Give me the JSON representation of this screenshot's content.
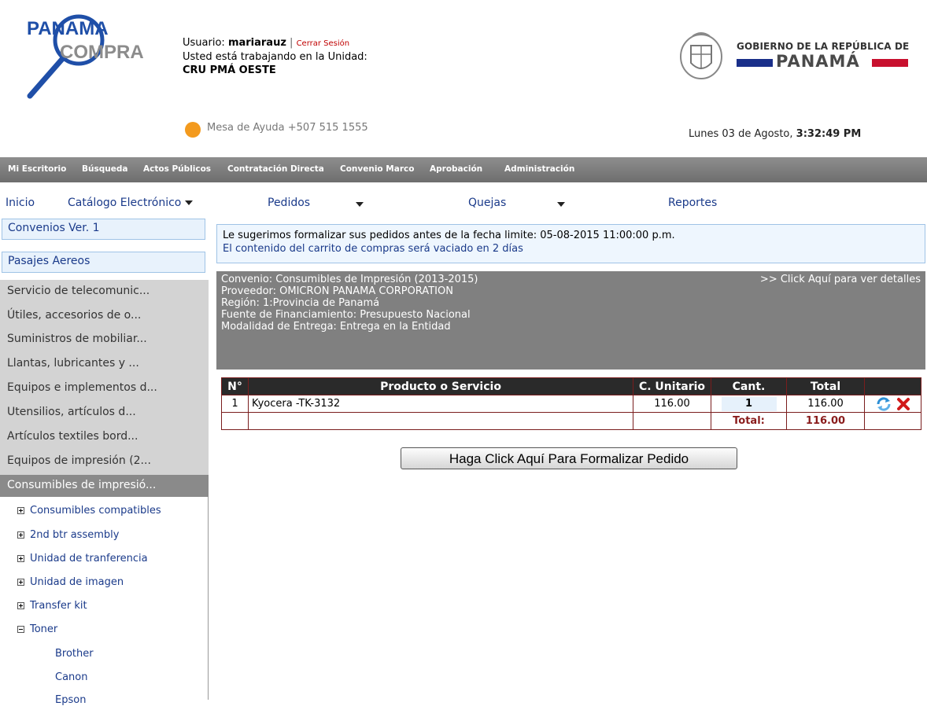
{
  "brand": {
    "logo_line1": "PANAMA",
    "logo_line2": "COMPRA"
  },
  "user": {
    "label": "Usuario:",
    "username": "mariarauz",
    "separator": "|",
    "logout": "Cerrar Sesión",
    "unit_label": "Usted está trabajando en la Unidad:",
    "unit_name": "CRU PMÁ OESTE"
  },
  "government": {
    "line1": "GOBIERNO DE LA REPÚBLICA DE",
    "line2": "PANAMÁ"
  },
  "helpdesk": {
    "text": "Mesa de Ayuda +507 515 1555"
  },
  "datetime": {
    "date": "Lunes 03 de Agosto,",
    "time": "3:32:49 PM"
  },
  "topnav": [
    "Mi Escritorio",
    "Búsqueda",
    "Actos Públicos",
    "Contratación Directa",
    "Convenio Marco",
    "Aprobación",
    "Administración"
  ],
  "subnav": {
    "home": "Inicio",
    "catalog": "Catálogo Electrónico",
    "orders": "Pedidos",
    "complaints": "Quejas",
    "reports": "Reportes"
  },
  "sidebar": {
    "boxes": [
      "Convenios Ver. 1",
      "Pasajes Aereos"
    ],
    "categories": [
      "Servicio de telecomunic...",
      "Útiles, accesorios de o...",
      "Suministros de mobiliar...",
      "Llantas, lubricantes y ...",
      "Equipos e implementos d...",
      "Utensilios, artículos d...",
      "Artículos textiles bord...",
      "Equipos de impresión (2..."
    ],
    "active": "Consumibles de impresió...",
    "tree": [
      "Consumibles compatibles",
      "2nd btr assembly",
      "Unidad de tranferencia",
      "Unidad de imagen",
      "Transfer kit",
      "Toner"
    ],
    "tree_sub": [
      "Brother",
      "Canon",
      "Epson"
    ]
  },
  "notice": {
    "line1": "Le sugerimos formalizar sus pedidos antes de la fecha limite: 05-08-2015 11:00:00 p.m.",
    "line2": "El contenido del carrito de compras será vaciado en 2 días"
  },
  "convenio": {
    "convenio": "Convenio: Consumibles de Impresión (2013-2015)",
    "proveedor": "Proveedor: OMICRON PANAMA CORPORATION",
    "region": "Región: 1:Provincia de Panamá",
    "fuente": "Fuente de Financiamiento: Presupuesto Nacional",
    "modalidad": "Modalidad de Entrega: Entrega en la Entidad",
    "details_link": ">> Click Aquí para ver detalles"
  },
  "cart": {
    "headers": {
      "num": "N°",
      "product": "Producto o Servicio",
      "unit": "C. Unitario",
      "qty": "Cant.",
      "total": "Total"
    },
    "row": {
      "num": "1",
      "product": "Kyocera -TK-3132",
      "unit": "116.00",
      "qty": "1",
      "total": "116.00"
    },
    "total_label": "Total:",
    "total_value": "116.00"
  },
  "actions": {
    "formalize": "Haga Click Aquí Para Formalizar Pedido"
  },
  "colors": {
    "nav_gray": "#808080",
    "link_blue": "#1a3a8a",
    "logout_red": "#c00000",
    "total_red": "#8a1c1c"
  }
}
